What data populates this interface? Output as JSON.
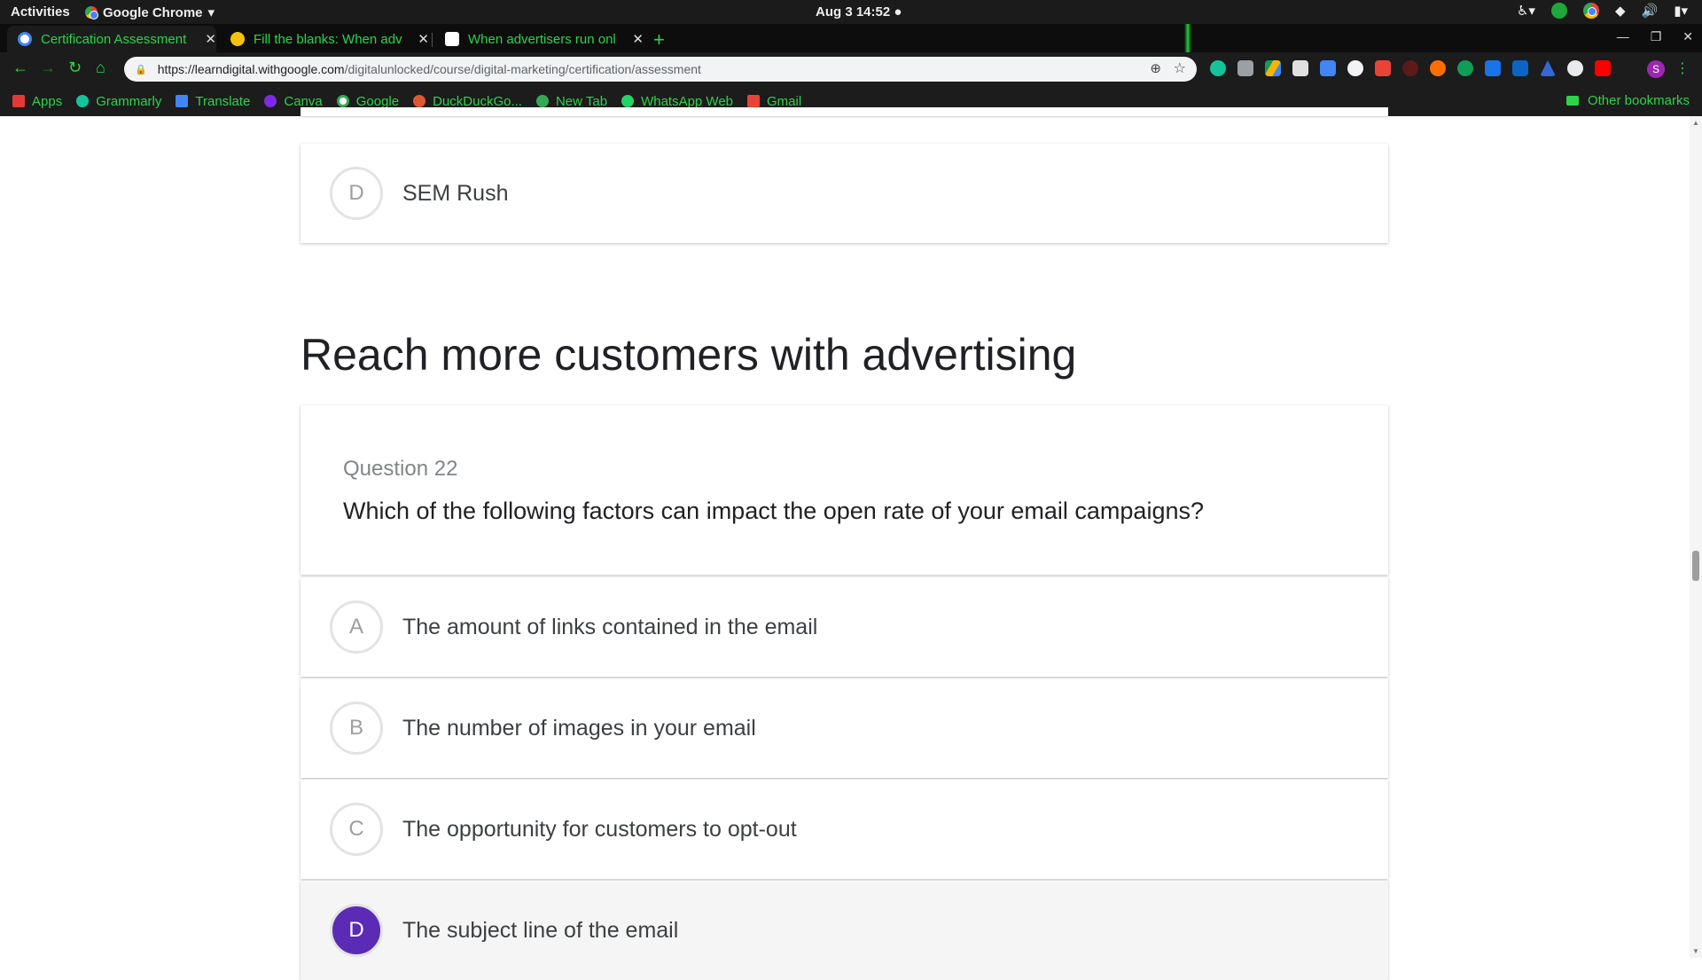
{
  "system_bar": {
    "activities": "Activities",
    "app_name": "Google Chrome",
    "clock": "Aug 3  14:52"
  },
  "tabs": [
    {
      "title": "Certification Assessment",
      "favicon_color": "#ffffff"
    },
    {
      "title": "Fill the blanks: When adv",
      "favicon_color": "#f4c20d"
    },
    {
      "title": "When advertisers run onl",
      "favicon_color": "#ffffff"
    }
  ],
  "omnibox": {
    "host": "https://learndigital.withgoogle.com",
    "path": "/digitalunlocked/course/digital-marketing/certification/assessment"
  },
  "profile_initial": "S",
  "bookmarks": [
    {
      "label": "Apps",
      "color": "#e53935"
    },
    {
      "label": "Grammarly",
      "color": "#15c39a"
    },
    {
      "label": "Translate",
      "color": "#4285f4"
    },
    {
      "label": "Canva",
      "color": "#7d2ae8"
    },
    {
      "label": "Google",
      "color": "#ffffff"
    },
    {
      "label": "DuckDuckGo...",
      "color": "#de5833"
    },
    {
      "label": "New Tab",
      "color": "#34a853"
    },
    {
      "label": "WhatsApp Web",
      "color": "#25d366"
    },
    {
      "label": "Gmail",
      "color": "#ea4335"
    }
  ],
  "other_bookmarks": "Other bookmarks",
  "prev_question": {
    "option_d": {
      "letter": "D",
      "text": "SEM Rush"
    }
  },
  "section_title": "Reach more customers with advertising",
  "question": {
    "number": "Question 22",
    "text": "Which of the following factors can impact the open rate of your email campaigns?",
    "options": [
      {
        "letter": "A",
        "text": "The amount of links contained in the email",
        "selected": false
      },
      {
        "letter": "B",
        "text": "The number of images in your email",
        "selected": false
      },
      {
        "letter": "C",
        "text": "The opportunity for customers to opt-out",
        "selected": false
      },
      {
        "letter": "D",
        "text": "The subject line of the email",
        "selected": true
      }
    ]
  },
  "colors": {
    "accent_selected": "#5b2bb6",
    "chrome_theme_green": "#2ed34a"
  }
}
